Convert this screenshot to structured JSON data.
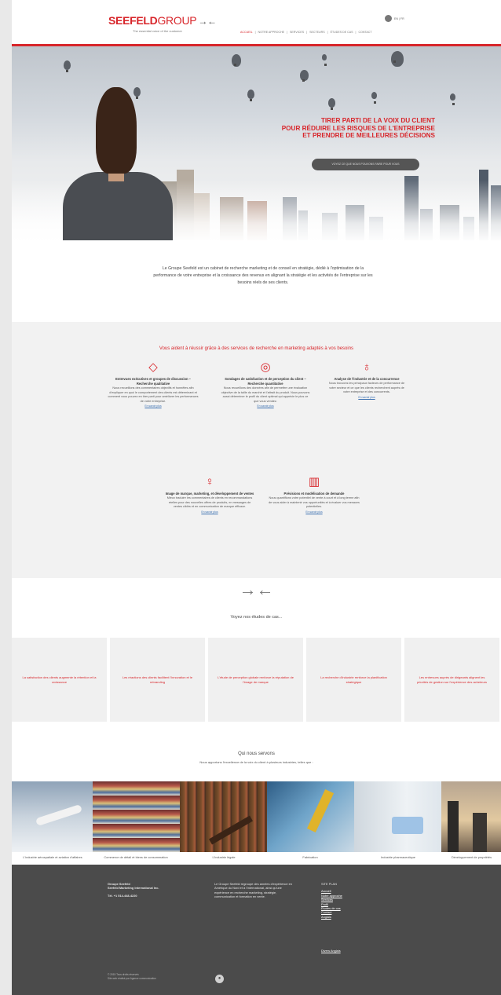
{
  "header": {
    "logo_bold": "SEEFELD",
    "logo_light": "GROUP",
    "logo_arrows": "→←",
    "tagline": "The essential voice of the customer",
    "lang": "EN | FR",
    "nav": [
      "ACCUEIL",
      "NOTRE APPROCHE",
      "SERVICES",
      "SECTEURS",
      "ÉTUDES DE CAS",
      "CONTACT"
    ]
  },
  "hero": {
    "line1": "TIRER PARTI DE LA VOIX DU CLIENT",
    "line2": "POUR RÉDUIRE LES RISQUES DE L'ENTREPRISE",
    "line3": "ET PRENDRE DE MEILLEURES DÉCISIONS",
    "button": "VOYEZ CE QUE NOUS POUVONS FAIRE POUR VOUS"
  },
  "intro": "Le Groupe Seefeld est un cabinet de recherche marketing et de conseil en stratégie, dédié à l'optimisation de la performance de votre entreprise et la croissance des revenus en alignant la stratégie et les activités de l'entreprise sur les besoins réels de ses clients.",
  "services": {
    "title": "Vous aident à réussir grâce à des services de recherche en marketing adaptés à vos besoins",
    "items": [
      {
        "icon": "diamond-icon",
        "glyph": "◇",
        "title": "Entrevues exécutives et groupes de discussion – Recherche qualitative",
        "desc": "Nous recueillons des commentaires objectifs et honnêtes afin d'expliquer en quoi le comportement des clients est déterminant et comment vous pouvez en tirer parti pour améliorer les performances de votre entreprise.",
        "more": "En savoir plus"
      },
      {
        "icon": "target-icon",
        "glyph": "◎",
        "title": "Sondages de satisfaction et de perception du client – Recherche quantitative",
        "desc": "Nous recueillons des données afin de permettre une évaluation objective de la taille du marché et l'attrait du produit. Nous pouvons aussi déterminer le profil du client optimal qui apprécie le plus ce que vous vendez.",
        "more": "En savoir plus"
      },
      {
        "icon": "lightbulb-icon",
        "glyph": "♁",
        "title": "Analyse de l'industrie et de la concurrence",
        "desc": "Nous trouvons les principaux facteurs de performance de votre secteur et ce que les clients recherchent auprès de votre entreprise et des concurrents.",
        "more": "En savoir plus"
      },
      {
        "icon": "bulb-icon",
        "glyph": "♀",
        "title": "Image de marque, marketing, et développement de ventes",
        "desc": "Mieux traduire les commentaires de clients en recommandations réelles pour des nouvelles offres de produits, en messages de ventes ciblés et en communication de marque efficace.",
        "more": "En savoir plus"
      },
      {
        "icon": "bar-chart-icon",
        "glyph": "▥",
        "title": "Prévisions et modélisation de demande",
        "desc": "Nous quantifions votre potentiel de vente à court et à long terme afin de vous aider à maintenir vos opportunités et à évaluer vos menaces potentielles.",
        "more": "En savoir plus"
      }
    ]
  },
  "cases": {
    "arrows": "→←",
    "title": "Voyez nos études de cas...",
    "items": [
      "La satisfaction des clients augmente la rétention et la croissance",
      "Les réactions des clients facilitent l'innovation et le rebranding",
      "L'étude de perception globale renforce la réputation de l'image de marque",
      "La recherche d'industrie renforce la planification stratégique",
      "Les entrevues auprès de dirigeants alignent les priorités de gestion sur l'expérience des acheteurs"
    ]
  },
  "serve": {
    "title": "Qui nous servons",
    "subtitle": "Nous apportons l'excellence de la voix du client à plusieurs industries, telles que :",
    "industries": [
      "L'industrie aérospatiale et aviation d'affaires",
      "Commerce de détail et biens de consommation",
      "L'industrie légale",
      "Fabrication",
      "Industrie pharmaceutique",
      "Développement de propriétés"
    ]
  },
  "footer": {
    "company": "Groupe Seefeld",
    "company2": "Seefeld Marketing International Inc.",
    "phone": "Tél. +1 514-448-4220",
    "copyright": "© 2015 Tous droits réservés",
    "credit": "Site web réalisé par Agence communication",
    "about": "Le Groupe Seefeld regroupe des années d'expérience en Amérique du Nord et à l'international, ainsi qu'une expérience en recherche marketing, stratégie, communication et formation en vente.",
    "links_title": "SITE PLAN",
    "links": [
      "Accueil",
      "Notre approche",
      "Services",
      "Profil",
      "Études de cas",
      "Contact",
      "Anglais"
    ],
    "last_link": "Divers Anglais"
  },
  "colors": {
    "accent": "#d8262b",
    "footer": "#4b4b4b"
  }
}
